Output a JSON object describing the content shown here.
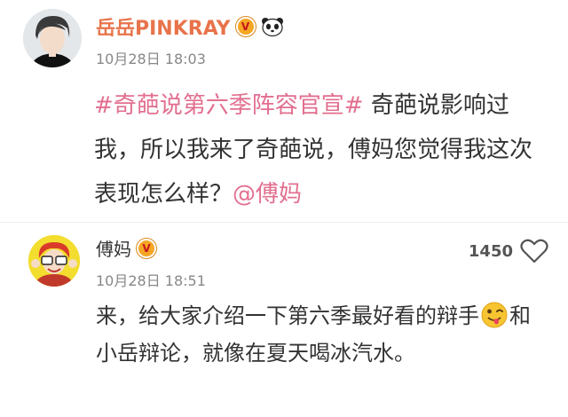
{
  "post": {
    "author": "岳岳PINKRAY",
    "time": "10月28日 18:03",
    "hashtag": "#奇葩说第六季阵容官宣#",
    "body": " 奇葩说影响过我，所以我来了奇葩说，傅妈您觉得我这次表现怎么样？",
    "mention": "@傅妈",
    "badge_icon": "verified-badge-icon",
    "panda_icon": "panda-icon"
  },
  "comment": {
    "author": "傅妈",
    "time": "10月28日 18:51",
    "like_count": "1450",
    "text_before": "来，给大家介绍一下第六季最好看的辩手",
    "text_after": "和小岳辩论，就像在夏天喝冰汽水。",
    "emoji_icon": "tongue-wink-emoji-icon",
    "like_icon": "heart-outline-icon"
  },
  "colors": {
    "author_name": "#e8734a",
    "hashtag": "#e26f8f",
    "badge": "#f5a623",
    "timestamp": "#888888"
  }
}
